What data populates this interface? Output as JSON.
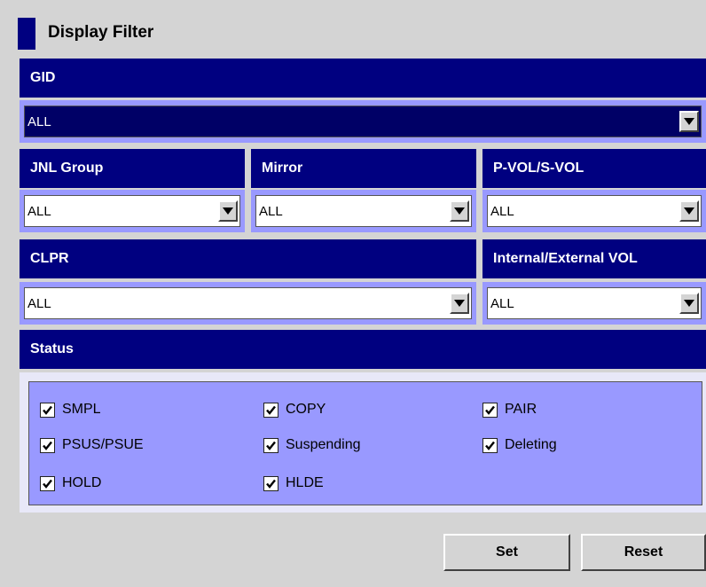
{
  "title": "Display Filter",
  "headers": {
    "gid": "GID",
    "jnl_group": "JNL Group",
    "mirror": "Mirror",
    "pvol_svol": "P-VOL/S-VOL",
    "clpr": "CLPR",
    "int_ext_vol": "Internal/External VOL",
    "status": "Status"
  },
  "selects": {
    "gid": "ALL",
    "jnl_group": "ALL",
    "mirror": "ALL",
    "pvol_svol": "ALL",
    "clpr": "ALL",
    "int_ext_vol": "ALL"
  },
  "status_options": [
    {
      "label": "SMPL",
      "checked": true
    },
    {
      "label": "COPY",
      "checked": true
    },
    {
      "label": "PAIR",
      "checked": true
    },
    {
      "label": "PSUS/PSUE",
      "checked": true
    },
    {
      "label": "Suspending",
      "checked": true
    },
    {
      "label": "Deleting",
      "checked": true
    },
    {
      "label": "HOLD",
      "checked": true
    },
    {
      "label": "HLDE",
      "checked": true
    }
  ],
  "buttons": {
    "set": "Set",
    "reset": "Reset"
  },
  "colors": {
    "header_bg": "#000080",
    "strip_bg": "#9999ff",
    "window_bg": "#d4d4d4"
  }
}
